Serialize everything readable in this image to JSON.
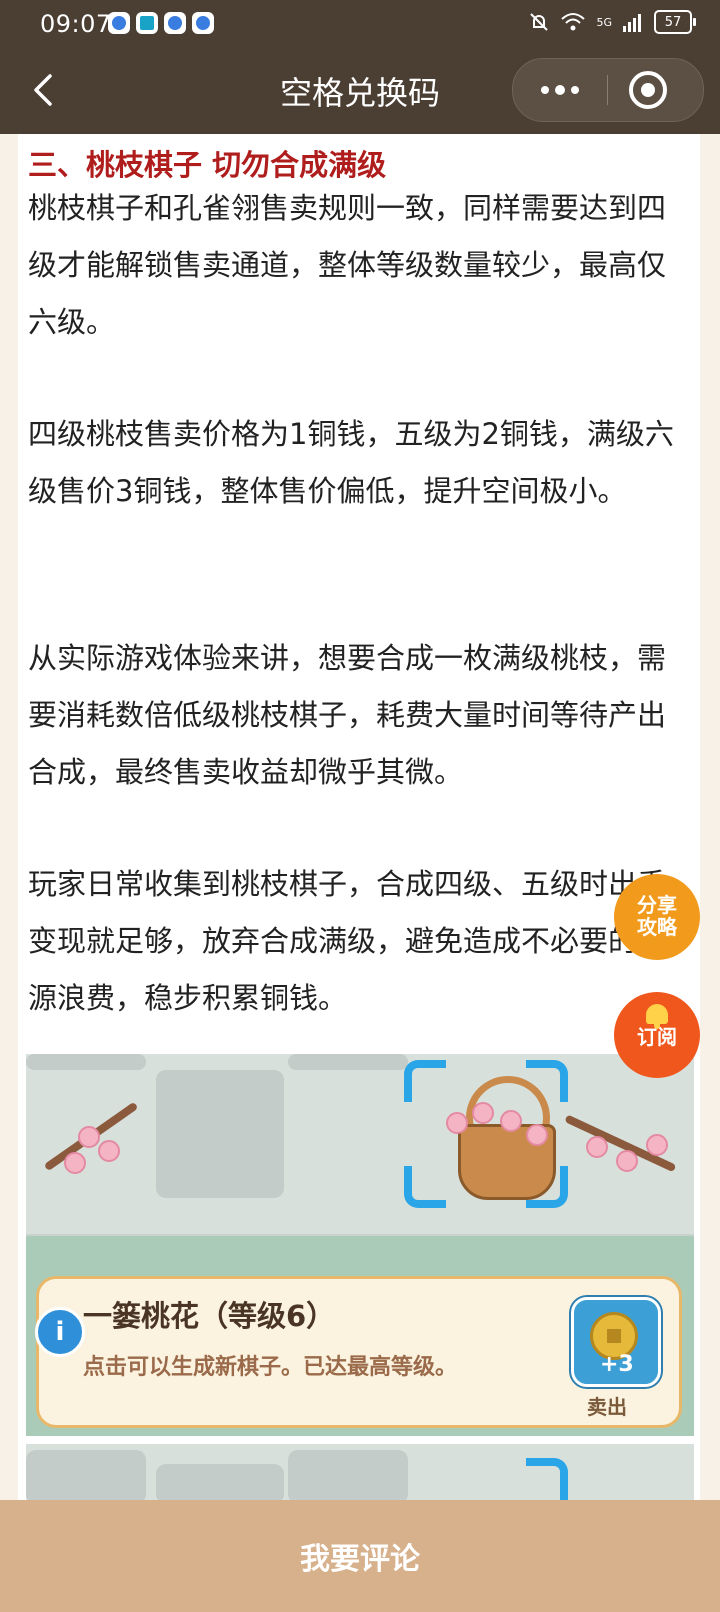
{
  "status_bar": {
    "time": "09:07",
    "battery": "57",
    "network": "5G"
  },
  "header": {
    "title": "空格兑换码"
  },
  "article": {
    "heading": "三、桃枝棋子 切勿合成满级",
    "paragraphs": [
      "桃枝棋子和孔雀翎售卖规则一致，同样需要达到四级才能解锁售卖通道，整体等级数量较少，最高仅六级。",
      "四级桃枝售卖价格为1铜钱，五级为2铜钱，满级六级售价3铜钱，整体售价偏低，提升空间极小。",
      "从实际游戏体验来讲，想要合成一枚满级桃枝，需要消耗数倍低级桃枝棋子，耗费大量时间等待产出合成，最终售卖收益却微乎其微。",
      "玩家日常收集到桃枝棋子，合成四级、五级时出手变现就足够，放弃合成满级，避免造成不必要的资源浪费，稳步积累铜钱。"
    ]
  },
  "game_screenshot": {
    "item_name": "一篓桃花（等级6）",
    "item_desc": "点击可以生成新棋子。已达最高等级。",
    "sell_amount": "+3",
    "sell_label": "卖出",
    "info_icon": "i"
  },
  "floating": {
    "share_label": "分享攻略",
    "subscribe_label": "订阅"
  },
  "bottom_bar": {
    "comment_label": "我要评论"
  }
}
